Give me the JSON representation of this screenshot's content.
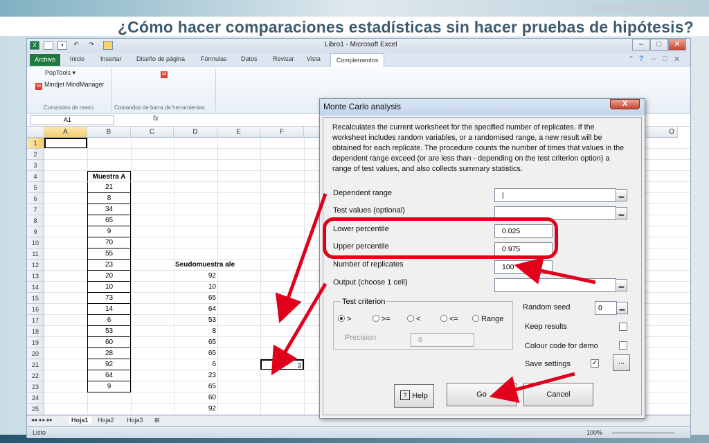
{
  "slide": {
    "subtitle": "Seminario Científico",
    "title": "¿Cómo hacer comparaciones estadísticas sin hacer pruebas de hipótesis?"
  },
  "excel": {
    "window_title": "Libro1 - Microsoft Excel",
    "ribbon_tabs": [
      "Archivo",
      "Inicio",
      "Insertar",
      "Diseño de página",
      "Fórmulas",
      "Datos",
      "Revisar",
      "Vista",
      "Complementos"
    ],
    "ribbon": {
      "poptools": "PopTools",
      "mindjet": "Mindjet MindManager",
      "group1": "Comandos de menú",
      "group2": "Comandos de barra de herramientas"
    },
    "name_box": "A1",
    "fx": "fx",
    "columns": [
      "A",
      "B",
      "C",
      "D",
      "E",
      "F"
    ],
    "last_column": "O",
    "rows": [
      "1",
      "2",
      "3",
      "4",
      "5",
      "6",
      "7",
      "8",
      "9",
      "10",
      "11",
      "12",
      "13",
      "14",
      "15",
      "16",
      "17",
      "18",
      "19",
      "20",
      "21",
      "22",
      "23",
      "24",
      "25"
    ],
    "col_b_header": "Muestra A",
    "col_b_values": [
      "21",
      "8",
      "34",
      "65",
      "9",
      "70",
      "55",
      "23",
      "20",
      "10",
      "73",
      "14",
      "6",
      "53",
      "60",
      "28",
      "92",
      "64",
      "9"
    ],
    "col_d_header": "Seudomuestra ale",
    "col_d_values": [
      "92",
      "10",
      "65",
      "64",
      "53",
      "8",
      "65",
      "65",
      "6",
      "23",
      "65",
      "60",
      "92"
    ],
    "f18": "3",
    "sheet_tabs": [
      "Hoja1",
      "Hoja2",
      "Hoja3"
    ],
    "status": "Listo",
    "zoom": "100%"
  },
  "dialog": {
    "title": "Monte Carlo analysis",
    "close": "X",
    "description": "Recalculates the current worksheet for the specified number of replicates. If the worksheet includes random variables, or a randomised range, a new result will be obtained for each replicate. The procedure counts the number of times that values in the dependent range exceed (or are less than - depending on the test criterion option) a range of test values, and also collects summary statistics.",
    "dependent_range": "Dependent range",
    "test_values": "Test values (optional)",
    "lower_percentile": "Lower percentile",
    "lower_value": "0.025",
    "upper_percentile": "Upper percentile",
    "upper_value": "0.975",
    "replicates": "Number of replicates",
    "replicates_value": "100",
    "output": "Output (choose 1 cell)",
    "test_criterion": "Test criterion",
    "criteria": [
      ">",
      ">=",
      "<",
      "<=",
      "Range"
    ],
    "precision": "Precision",
    "precision_value": "6",
    "random_seed": "Random seed",
    "seed_value": "0",
    "keep_results": "Keep results",
    "colour_code": "Colour code for demo",
    "save_settings": "Save settings",
    "save_checked": "✓",
    "ellipsis": "...",
    "help": "Help",
    "go": "Go",
    "cancel": "Cancel"
  },
  "colors": {
    "highlight": "#e0001b",
    "excel_green": "#1e7a3c"
  }
}
